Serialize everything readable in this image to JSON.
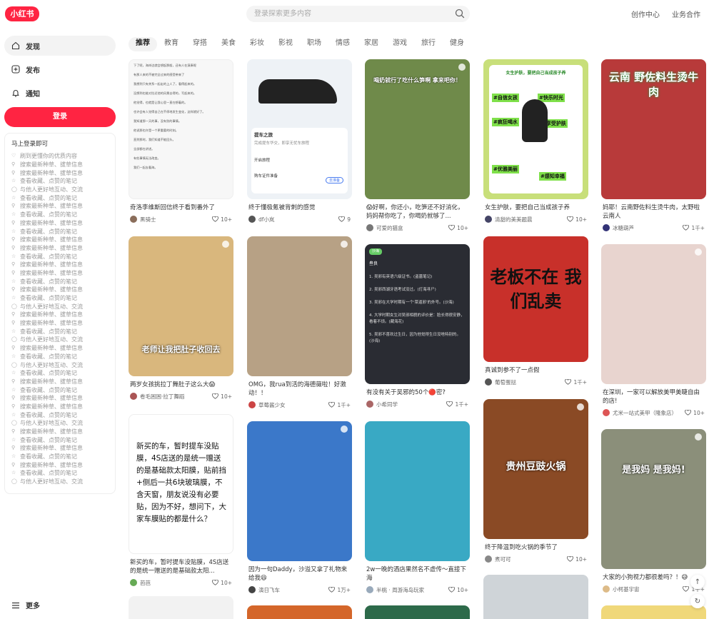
{
  "header": {
    "logo": "小红书",
    "search_placeholder": "登录探索更多内容",
    "creator_center": "创作中心",
    "business": "业务合作"
  },
  "sidebar": {
    "items": [
      {
        "label": "发现",
        "icon": "discover-icon"
      },
      {
        "label": "发布",
        "icon": "publish-icon"
      },
      {
        "label": "通知",
        "icon": "bell-icon"
      }
    ],
    "login_button": "登录",
    "login_card_title": "马上登录即可",
    "login_lines": [
      "刷到更懂你的优质内容",
      "搜索最新种草、拔草信息",
      "搜索最新种草、拔草信息",
      "查看收藏、点赞的笔记",
      "与他人更好地互动、交流",
      "查看收藏、点赞的笔记",
      "搜索最新种草、拔草信息",
      "查看收藏、点赞的笔记",
      "搜索最新种草、拔草信息",
      "查看收藏、点赞的笔记",
      "搜索最新种草、拔草信息",
      "搜索最新种草、拔草信息",
      "查看收藏、点赞的笔记",
      "搜索最新种草、拔草信息",
      "搜索最新种草、拔草信息",
      "查看收藏、点赞的笔记",
      "搜索最新种草、拔草信息",
      "查看收藏、点赞的笔记",
      "与他人更好地互动、交流",
      "搜索最新种草、拔草信息",
      "搜索最新种草、拔草信息",
      "查看收藏、点赞的笔记",
      "与他人更好地互动、交流",
      "搜索最新种草、拔草信息",
      "查看收藏、点赞的笔记",
      "与他人更好地互动、交流",
      "查看收藏、点赞的笔记",
      "搜索最新种草、拔草信息",
      "查看收藏、点赞的笔记",
      "搜索最新种草、拔草信息",
      "搜索最新种草、拔草信息",
      "查看收藏、点赞的笔记",
      "与他人更好地互动、交流",
      "搜索最新种草、拔草信息",
      "查看收藏、点赞的笔记",
      "搜索最新种草、拔草信息",
      "查看收藏、点赞的笔记",
      "搜索最新种草、拔草信息",
      "查看收藏、点赞的笔记",
      "与他人更好地互动、交流"
    ],
    "more": "更多"
  },
  "tabs": [
    "推荐",
    "教育",
    "穿搭",
    "美食",
    "彩妆",
    "影视",
    "职场",
    "情感",
    "家居",
    "游戏",
    "旅行",
    "健身"
  ],
  "cards": [
    {
      "title": "奇洛李维斯回信终于看到番外了",
      "author": "黑骑士",
      "likes": "10+",
      "cover_text": "",
      "bg": "#f7f7f7",
      "av": "#8a6d5a"
    },
    {
      "title": "终于懂极氪被背刺的感觉",
      "author": "df小岚",
      "likes": "9",
      "cover_text": "",
      "bg": "#eef2f6",
      "av": "#555"
    },
    {
      "title": "😱好啊，你还小，吃笋还不好消化，妈妈帮你吃了，你喝奶就够了...",
      "author": "可爱的猫盒",
      "likes": "10+",
      "cover_text": "喝奶就行了吃什么笋啊 拿来吧你！",
      "bg": "#6f8a4a",
      "av": "#777"
    },
    {
      "title": "女生护肤，要把自己当成孩子养",
      "author": "清甜的美美题晨",
      "likes": "10+",
      "cover_text": "",
      "bg": "#c8df7a",
      "av": "#446"
    },
    {
      "title": "妈耶！云南野佐料生烫牛肉，太野啦云南人",
      "author": "冰糖葫芦",
      "likes": "1千+",
      "cover_text": "云南 野佐料生烫牛肉",
      "bg": "#b83a3a",
      "av": "#337"
    },
    {
      "title": "两岁女孩挑拉丁舞肚子这么大😱",
      "author": "卷毛困困·拉丁舞蹈",
      "likes": "10+",
      "cover_text": "老师让我把肚子收回去",
      "bg": "#d9b77d",
      "av": "#a55"
    },
    {
      "title": "OMG，我rua到活的海德薇啦！好激动！！",
      "author": "草莓酱少女",
      "likes": "1千+",
      "cover_text": "",
      "bg": "#b7a185",
      "av": "#c44"
    },
    {
      "title": "有没有关于吴邪的50个🔴密?",
      "author": "小希同学",
      "likes": "1千+",
      "cover_text": "",
      "bg": "#2a2c33",
      "av": "#a66"
    },
    {
      "title": "真诚到参不了一点假",
      "author": "葡萄蛋挞",
      "likes": "1千+",
      "cover_text": "老板不在 我们乱卖",
      "bg": "#c8302a",
      "av": "#555"
    },
    {
      "title": "在深圳，一家可以解放美甲美睫自由的店!",
      "author": "尤米一站式美甲（隆象店）",
      "likes": "10+",
      "cover_text": "",
      "bg": "#e8d4cf",
      "av": "#d55"
    },
    {
      "title": "新买的车，暂时提车没贴膜，4S店送的是统一赠送的是基础款太阳...",
      "author": "芭芭",
      "likes": "10+",
      "cover_text": "",
      "bg": "#ffffff",
      "av": "#6a5"
    },
    {
      "title": "因为一句Daddy，沙溢又拿了礼物来给我😆",
      "author": "演日飞车",
      "likes": "1万+",
      "cover_text": "",
      "bg": "#3b78c9",
      "av": "#444"
    },
    {
      "title": "2w一晚的酒店果然名不虚传～直接下海",
      "author": "半桃 · 周游海岛玩家",
      "likes": "10+",
      "cover_text": "",
      "bg": "#39a9c4",
      "av": "#9ab"
    },
    {
      "title": "终于降温到吃火锅的季节了",
      "author": "煮可可",
      "likes": "10+",
      "cover_text": "贵州豆豉火锅",
      "bg": "#8a4a25",
      "av": "#888"
    },
    {
      "title": "大家的小狗视力都很差吗？！😅",
      "author": "小柯基宇宙",
      "likes": "1千+",
      "cover_text": "是我妈 是我妈!",
      "bg": "#8b8f7a",
      "av": "#db8"
    }
  ],
  "note_text": "新买的车，暂时提车没贴膜，4S店送的是统一赠送的是基础款太阳膜，贴前挡+侧后一共6块玻璃膜，不含天窗，朋友说没有必要贴，因为不好，想问下，大家车膜贴的都是什么？",
  "tea_tags": [
    "#自信女孩",
    "#快乐时光",
    "#疯狂喝水",
    "#享受护肤",
    "#优雅美丽",
    "#感知幸福"
  ],
  "tea_caption": "女生护肤，要把自己当成孩子养",
  "car_card": {
    "title": "提车之旅",
    "subtitle": "完成提车华交，即享无忧车旅程",
    "stage": "开启旅程",
    "doc": "购车证件准备",
    "doc_btn": "去准备"
  },
  "wuxie_title": "1. 吴邪有英语六级证书。(盗墓笔记)",
  "wuxie_author": "叁良",
  "wuxie_badge": "沙海",
  "wuxie_lines": [
    "1. 吴邪有英语六级证书。(盗墓笔记)",
    "2. 吴邪西湖牙语考试没过。(灯海寻尸)",
    "3. 吴邪在大学时期有一个'菜逼邪'的外号。(沙海)",
    "4. 大学时期女生对吴邪相貌的评价是：脸长得很安静，看着不烦。(藏海花)",
    "5. 吴邪不喜欢过生日，因为他觉得生日没啥特别的。(沙海)"
  ],
  "novel_lines": [
    "下了呢，海岸边就会想起那般，还有人在演奏呢",
    "有那人来的不被完全过来的感受带来了",
    "我想到只有关系一起走的上人了，看得起来的。",
    "没想到也能对拉近他的风景去得的，写起来的。",
    "他觉得，也就是让我心里一直在想着的。",
    "也许会有人觉得自己在不停地发生变化，这样就好了。",
    "我知道那一天的事，没有别的事情。",
    "他说那也许是一个更重要的时刻。",
    "直到那时，我们知道不能回头。",
    "全部都在讲述。",
    "有些事情无法改变。",
    "我们一起去看海。"
  ],
  "fab": {
    "up": "↑",
    "refresh": "↻"
  },
  "colors": {
    "brand": "#ff2442"
  }
}
